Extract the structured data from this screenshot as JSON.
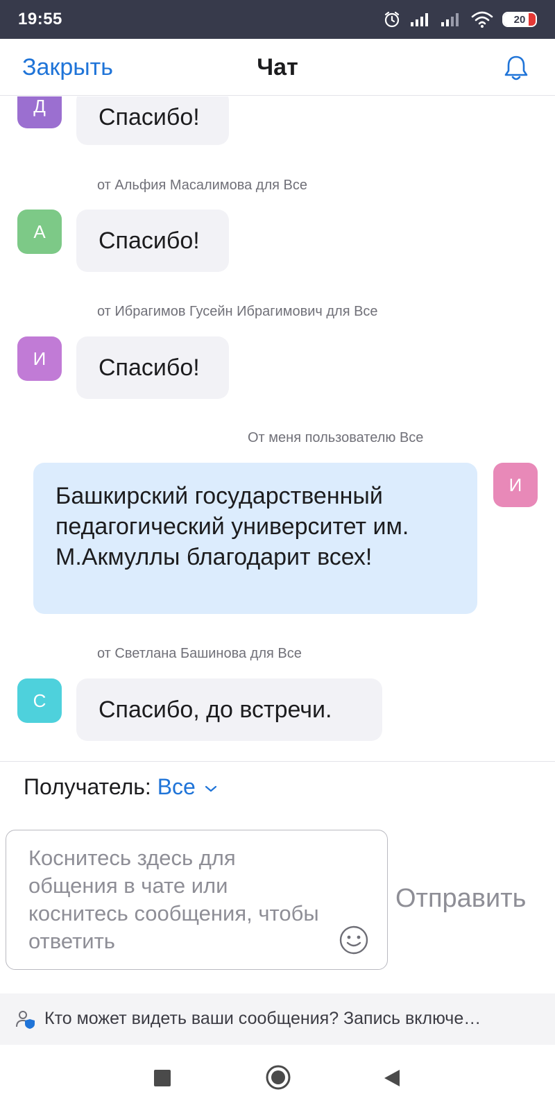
{
  "status_bar": {
    "time": "19:55",
    "battery": "20"
  },
  "header": {
    "close_label": "Закрыть",
    "title": "Чат"
  },
  "messages": [
    {
      "avatar_letter": "Д",
      "avatar_color": "#9b6fd0",
      "sender": "",
      "text": "Спасибо!"
    },
    {
      "avatar_letter": "А",
      "avatar_color": "#7dc987",
      "sender": "от Альфия Масалимова для Все",
      "text": "Спасибо!"
    },
    {
      "avatar_letter": "И",
      "avatar_color": "#c17bd6",
      "sender": "от Ибрагимов Гусейн Ибрагимович для Все",
      "text": "Спасибо!"
    },
    {
      "avatar_letter": "И",
      "avatar_color": "#e889b8",
      "sender": "От меня пользователю Все",
      "text": "Башкирский государственный педагогический университет им. М.Акмуллы благодарит всех!"
    },
    {
      "avatar_letter": "С",
      "avatar_color": "#4ed1dc",
      "sender": "от Светлана Башинова для Все",
      "text": "Спасибо, до встречи."
    }
  ],
  "composer": {
    "recipient_label": "Получатель:",
    "recipient_value": "Все",
    "placeholder": "Коснитесь здесь для общения в чате или коснитесь сообщения, чтобы ответить",
    "send_label": "Отправить"
  },
  "privacy_notice": "Кто может видеть ваши сообщения? Запись включе…",
  "colors": {
    "accent": "#1f74d8",
    "status_bar": "#373a4b",
    "incoming_bubble": "#f2f2f6",
    "outgoing_bubble": "#dcecfd"
  },
  "icons": {
    "bell": "bell-icon",
    "chevron": "chevron-down-icon",
    "emoji": "smiley-icon",
    "privacy": "user-shield-icon"
  }
}
